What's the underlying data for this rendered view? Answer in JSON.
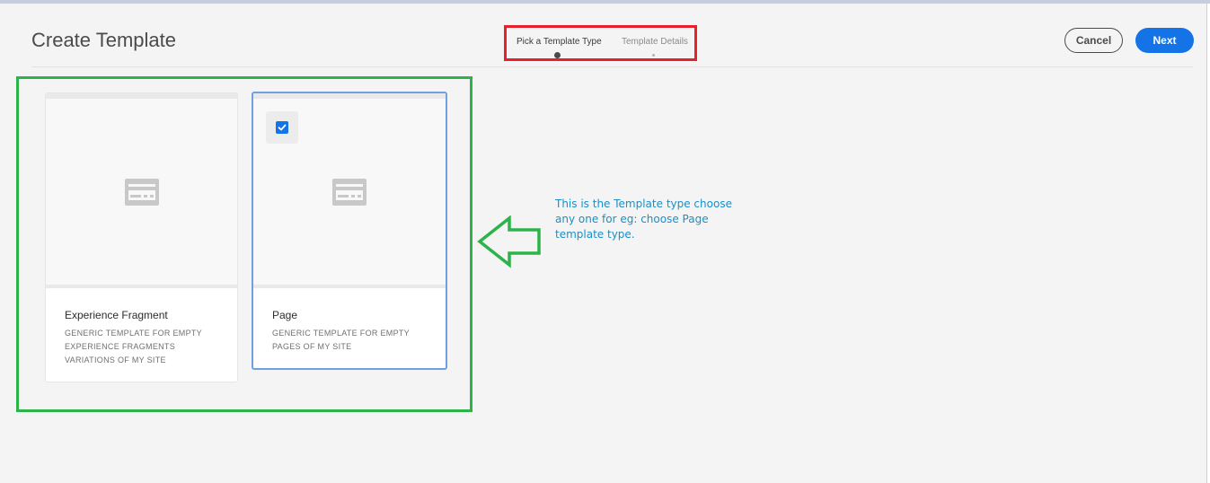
{
  "page": {
    "title": "Create Template"
  },
  "wizard": {
    "steps": [
      {
        "label": "Pick a Template Type",
        "active": true
      },
      {
        "label": "Template Details",
        "active": false
      }
    ]
  },
  "actions": {
    "cancel_label": "Cancel",
    "next_label": "Next"
  },
  "cards": [
    {
      "title": "Experience Fragment",
      "description": "GENERIC TEMPLATE FOR EMPTY EXPERIENCE FRAGMENTS VARIATIONS OF MY SITE",
      "selected": false,
      "icon": "template-icon"
    },
    {
      "title": "Page",
      "description": "GENERIC TEMPLATE FOR EMPTY PAGES OF MY SITE",
      "selected": true,
      "icon": "template-icon"
    }
  ],
  "annotation": {
    "text": "This is the Template type choose any one for eg: choose Page template type."
  },
  "colors": {
    "accent": "#1473e6",
    "highlight_red": "#e8202a",
    "highlight_green": "#2db34a",
    "annotation_text": "#1a8fc8"
  }
}
